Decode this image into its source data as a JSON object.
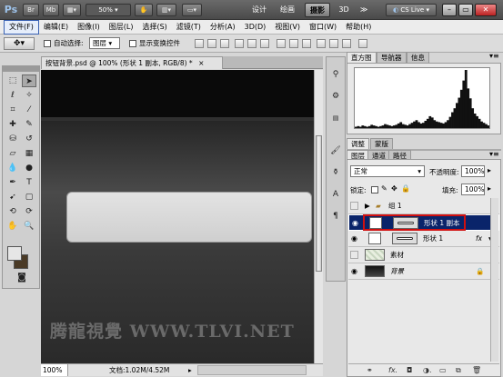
{
  "appbar": {
    "logo": "Ps",
    "btn_br": "Br",
    "btn_mb": "Mb",
    "zoom": "50%",
    "workspaces": [
      "设计",
      "绘画",
      "摄影",
      "3D"
    ],
    "more": "≫",
    "cs_live": "CS Live"
  },
  "menu": [
    "文件(F)",
    "编辑(E)",
    "图像(I)",
    "图层(L)",
    "选择(S)",
    "滤镜(T)",
    "分析(A)",
    "3D(D)",
    "视图(V)",
    "窗口(W)",
    "帮助(H)"
  ],
  "options": {
    "auto_select_label": "自动选择:",
    "auto_select_value": "图层",
    "show_transform_label": "显示变换控件"
  },
  "document": {
    "tab_title": "按钮背景.psd @ 100% (形状 1 副本, RGB/8) *",
    "tab_close": "×",
    "watermark": "腾龍視覺 WWW.TLVI.NET",
    "zoom": "100%",
    "doc_info": "文档:1.02M/4.52M"
  },
  "panels": {
    "histogram_tabs": [
      "直方图",
      "导航器",
      "信息"
    ],
    "histogram_data": [
      2,
      3,
      2,
      4,
      3,
      2,
      3,
      5,
      4,
      3,
      2,
      3,
      4,
      6,
      5,
      4,
      3,
      4,
      5,
      7,
      9,
      6,
      5,
      4,
      6,
      8,
      10,
      12,
      9,
      7,
      8,
      11,
      14,
      18,
      16,
      12,
      10,
      9,
      8,
      7,
      9,
      12,
      17,
      24,
      30,
      38,
      46,
      58,
      72,
      88,
      60,
      45,
      30,
      22,
      18,
      14,
      10,
      8,
      6,
      4
    ],
    "adjust_tabs": [
      "调整",
      "蒙版"
    ],
    "layers_tabs": [
      "图层",
      "通道",
      "路径"
    ],
    "blend_mode": "正常",
    "opacity_label": "不透明度:",
    "opacity_value": "100%",
    "lock_label": "锁定:",
    "fill_label": "填充:",
    "fill_value": "100%",
    "layers": [
      {
        "name": "组 1",
        "type": "group"
      },
      {
        "name": "形状 1 副本",
        "type": "shape",
        "selected": true
      },
      {
        "name": "形状 1",
        "type": "shape",
        "fx": "fx"
      },
      {
        "name": "素材",
        "type": "image"
      },
      {
        "name": "背景",
        "type": "background"
      }
    ]
  },
  "colors": {
    "selection": "#0a246a",
    "highlight_box": "#d01010",
    "fg_color": "#e6e6e6",
    "bg_color": "#4a3a26"
  }
}
